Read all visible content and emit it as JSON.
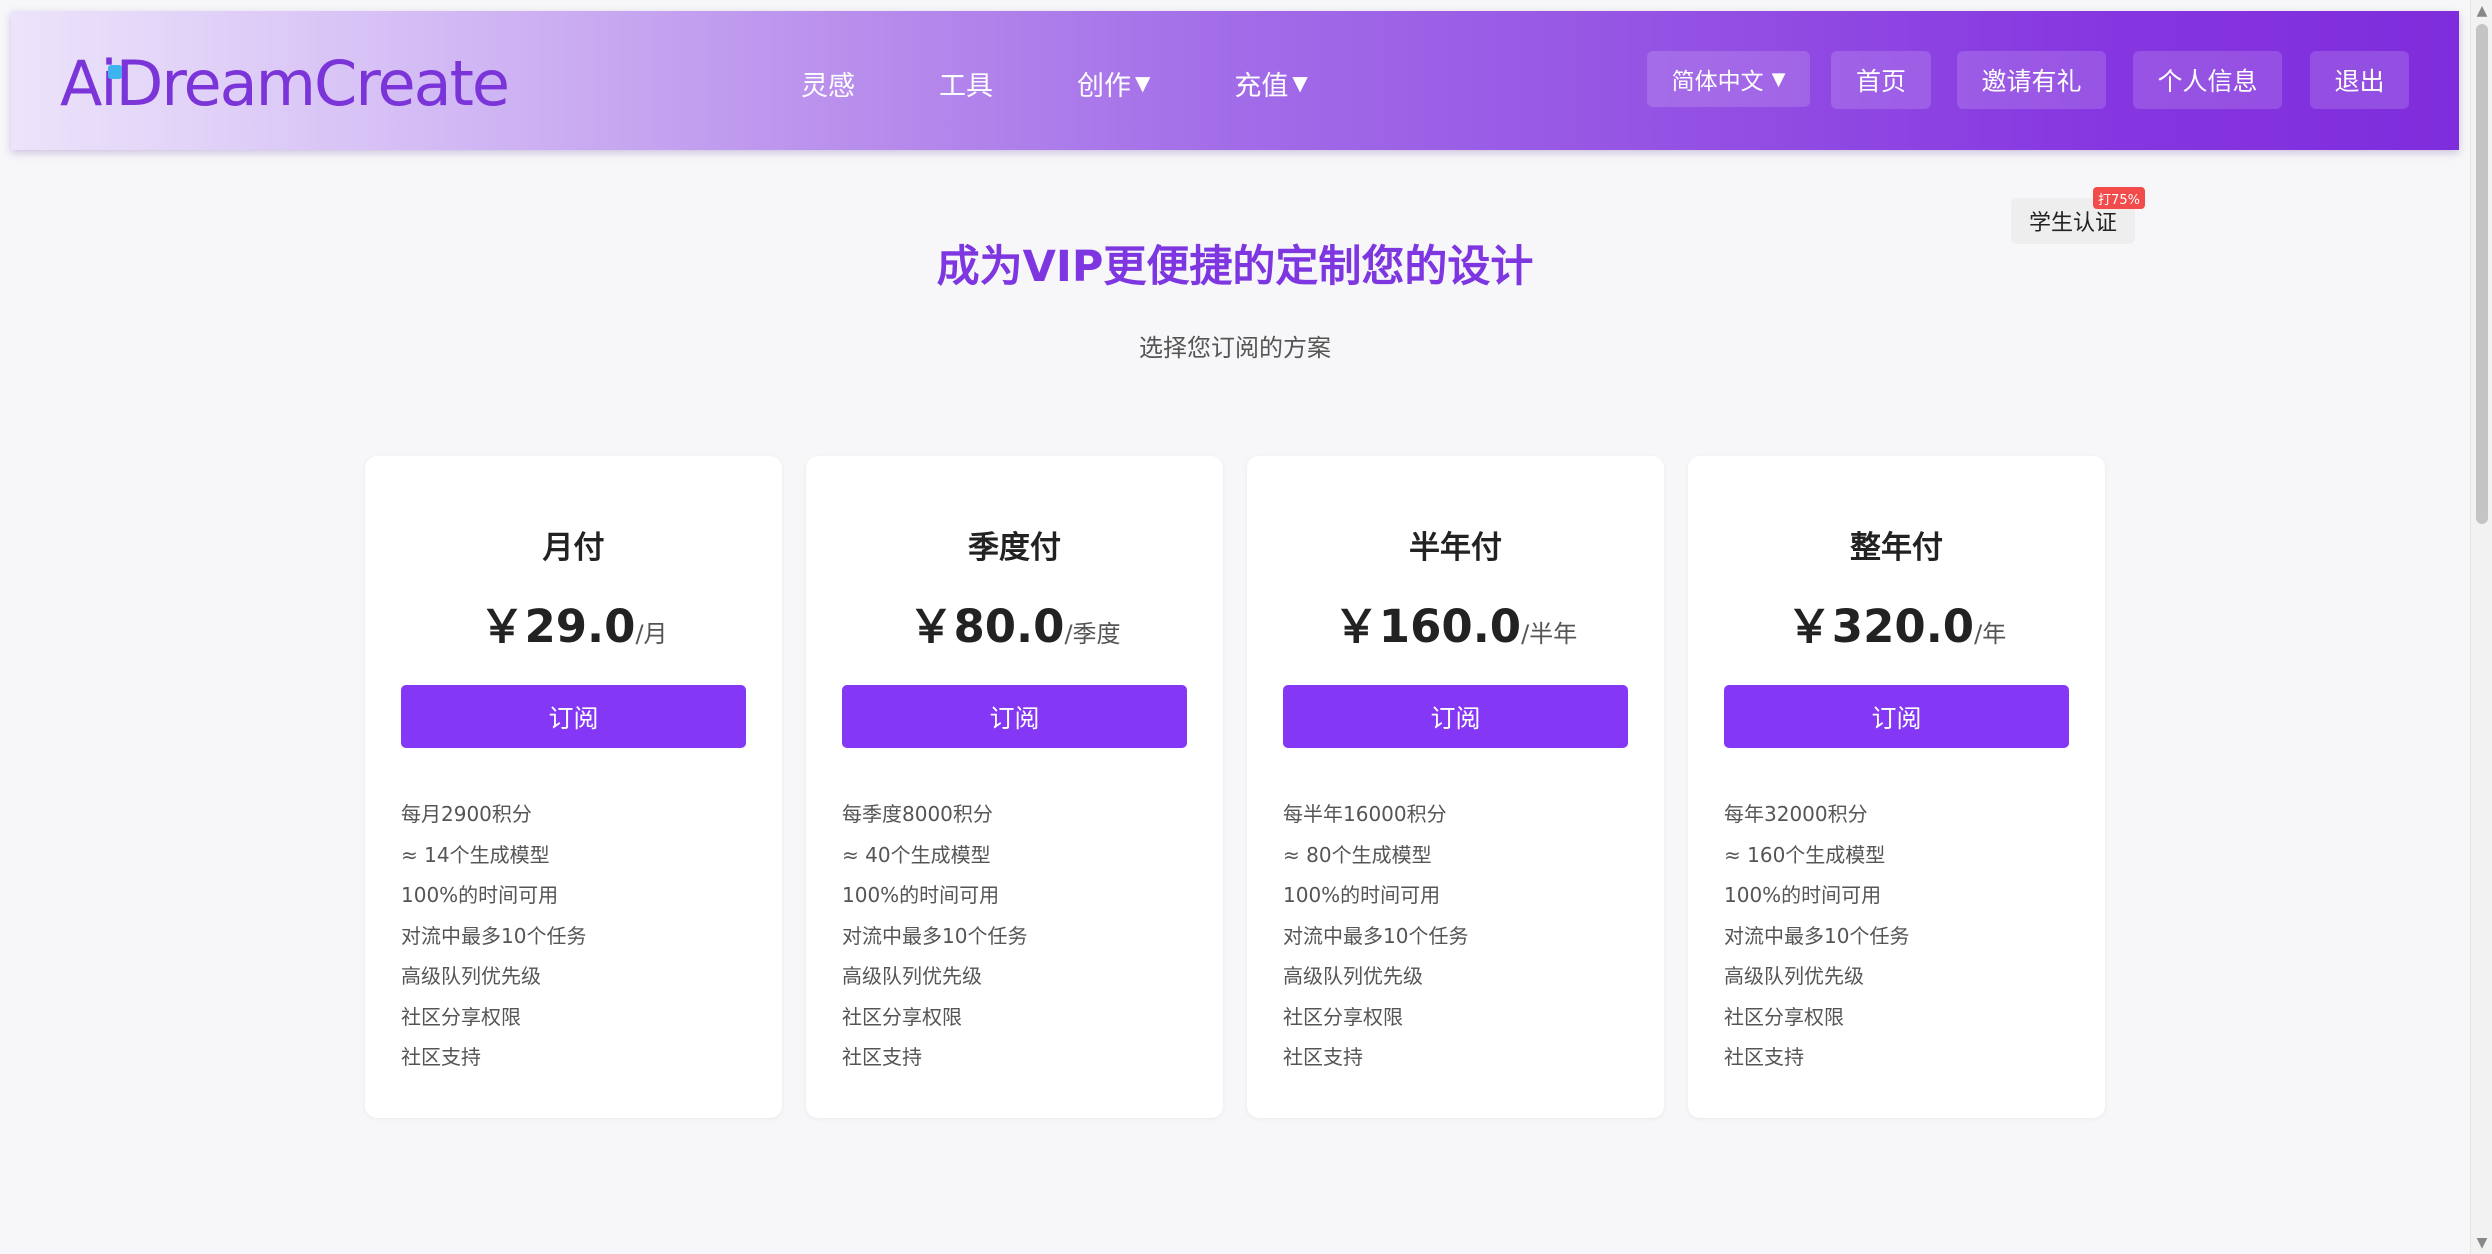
{
  "header": {
    "logo": "AiDreamCreate",
    "nav": [
      {
        "label": "灵感",
        "has_dropdown": false
      },
      {
        "label": "工具",
        "has_dropdown": false
      },
      {
        "label": "创作",
        "has_dropdown": true
      },
      {
        "label": "充值",
        "has_dropdown": true
      }
    ],
    "language": "简体中文",
    "buttons": {
      "home": "首页",
      "invite": "邀请有礼",
      "profile": "个人信息",
      "logout": "退出"
    }
  },
  "main": {
    "title": "成为VIP更便捷的定制您的设计",
    "subtitle": "选择您订阅的方案",
    "student_button": "学生认证",
    "discount_badge": "打75%"
  },
  "plans": [
    {
      "name": "月付",
      "price": "￥29.0",
      "period": "/月",
      "button": "订阅",
      "features": [
        "每月2900积分",
        "≈ 14个生成模型",
        "100%的时间可用",
        "对流中最多10个任务",
        "高级队列优先级",
        "社区分享权限",
        "社区支持"
      ]
    },
    {
      "name": "季度付",
      "price": "￥80.0",
      "period": "/季度",
      "button": "订阅",
      "features": [
        "每季度8000积分",
        "≈ 40个生成模型",
        "100%的时间可用",
        "对流中最多10个任务",
        "高级队列优先级",
        "社区分享权限",
        "社区支持"
      ]
    },
    {
      "name": "半年付",
      "price": "￥160.0",
      "period": "/半年",
      "button": "订阅",
      "features": [
        "每半年16000积分",
        "≈ 80个生成模型",
        "100%的时间可用",
        "对流中最多10个任务",
        "高级队列优先级",
        "社区分享权限",
        "社区支持"
      ]
    },
    {
      "name": "整年付",
      "price": "￥320.0",
      "period": "/年",
      "button": "订阅",
      "features": [
        "每年32000积分",
        "≈ 160个生成模型",
        "100%的时间可用",
        "对流中最多10个任务",
        "高级队列优先级",
        "社区分享权限",
        "社区支持"
      ]
    }
  ],
  "colors": {
    "accent": "#8437f4",
    "title": "#7d36e0",
    "badge": "#f24b4b",
    "logo_dot": "#3fb2f0"
  }
}
